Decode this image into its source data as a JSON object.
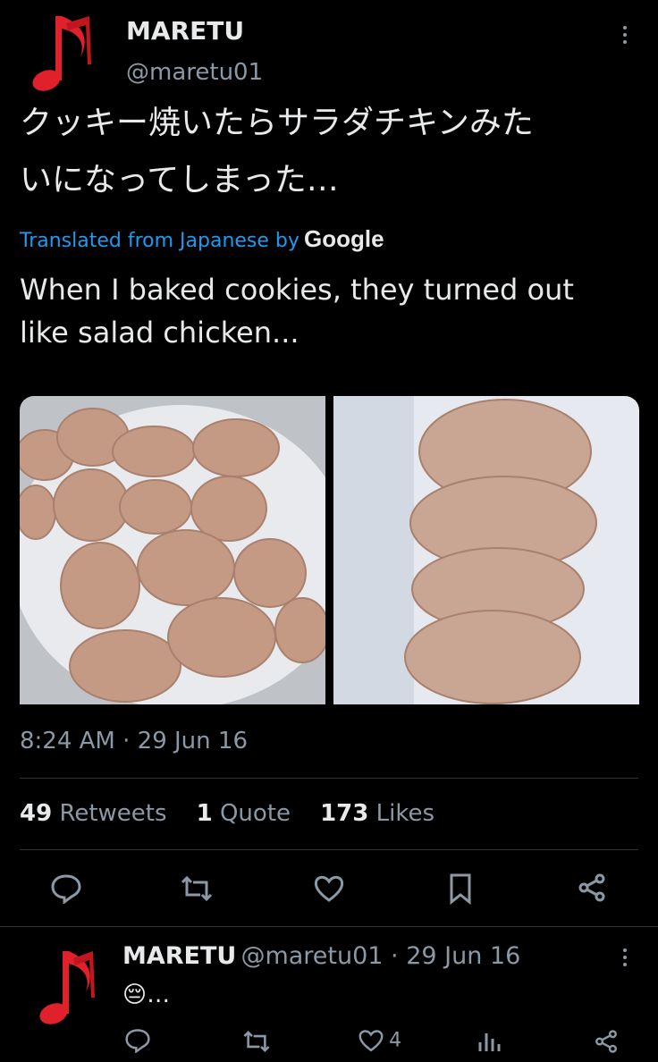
{
  "tweet": {
    "author_name": "MARETU",
    "author_handle": "@maretu01",
    "text_jp_line1": "クッキー焼いたらサラダチキンみた",
    "text_jp_line2": "いになってしまった…",
    "translated_label": "Translated from Japanese by",
    "translator": "Google",
    "text_en_line1": "When I baked cookies, they turned out",
    "text_en_line2": "like salad chicken...",
    "timestamp": "8:24 AM · 29 Jun 16",
    "stats": {
      "retweets_count": "49",
      "retweets_label": "Retweets",
      "quotes_count": "1",
      "quotes_label": "Quote",
      "likes_count": "173",
      "likes_label": "Likes"
    },
    "actions": [
      "reply-icon",
      "retweet-icon",
      "like-icon",
      "bookmark-icon",
      "share-icon"
    ]
  },
  "reply": {
    "author_name": "MARETU",
    "author_handle_date": "@maretu01 · 29 Jun 16",
    "text": "😔…",
    "like_count": "4",
    "actions": [
      "reply-icon",
      "retweet-icon",
      "like-icon",
      "views-icon",
      "share-icon"
    ]
  },
  "colors": {
    "background": "#000000",
    "text": "#e7e9ea",
    "muted": "#8b98a5",
    "link": "#1d9bf0",
    "avatar_red": "#e0202a"
  }
}
